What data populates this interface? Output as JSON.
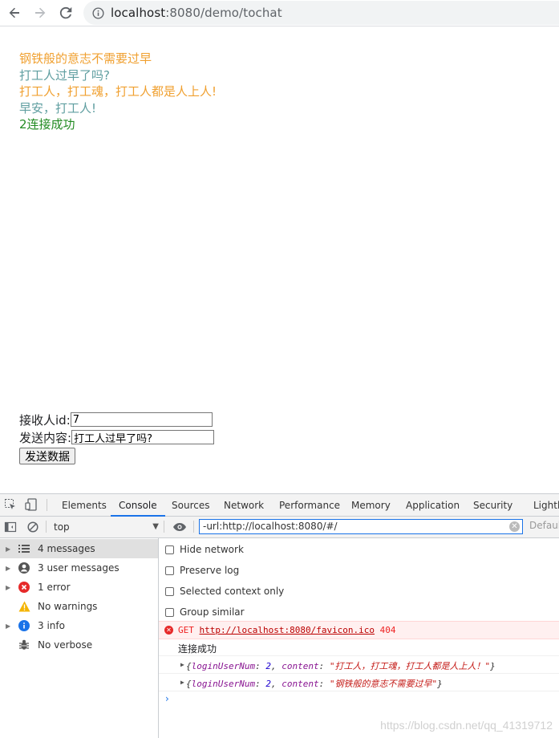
{
  "browser": {
    "url_host": "localhost",
    "url_rest": ":8080/demo/tochat"
  },
  "page": {
    "messages": [
      {
        "text": "钢铁般的意志不需要过早",
        "color": "#f0a030"
      },
      {
        "text": "打工人过早了吗?",
        "color": "#5f9ea0"
      },
      {
        "text": "打工人，打工魂，打工人都是人上人!",
        "color": "#f0a030"
      },
      {
        "text": "早安，打工人!",
        "color": "#5f9ea0"
      },
      {
        "text": "2连接成功",
        "color": "#228b22"
      }
    ],
    "form": {
      "receiver_label": "接收人id:",
      "receiver_value": "7",
      "content_label": "发送内容:",
      "content_value": "打工人过早了吗?",
      "send_label": "发送数据"
    }
  },
  "devtools": {
    "tabs": [
      "Elements",
      "Console",
      "Sources",
      "Network",
      "Performance",
      "Memory",
      "Application",
      "Security",
      "Lighth"
    ],
    "active_tab": "Console",
    "context": "top",
    "filter_value": "-url:http://localhost:8080/#/",
    "default_levels": "Default",
    "sidebar": [
      {
        "label": "4 messages",
        "icon": "list-icon",
        "selected": true
      },
      {
        "label": "3 user messages",
        "icon": "user-icon",
        "selected": false
      },
      {
        "label": "1 error",
        "icon": "error-icon",
        "selected": false
      },
      {
        "label": "No warnings",
        "icon": "warning-icon",
        "selected": false
      },
      {
        "label": "3 info",
        "icon": "info-icon",
        "selected": false
      },
      {
        "label": "No verbose",
        "icon": "bug-icon",
        "selected": false
      }
    ],
    "settings": [
      "Hide network",
      "Preserve log",
      "Selected context only",
      "Group similar"
    ],
    "console": {
      "error_method": "GET",
      "error_url": "http://localhost:8080/favicon.ico",
      "error_code": "404",
      "log_text": "连接成功",
      "objects": [
        {
          "k1": "loginUserNum",
          "v1": "2",
          "k2": "content",
          "v2": "\"打工人，打工魂，打工人都是人上人！\""
        },
        {
          "k1": "loginUserNum",
          "v1": "2",
          "k2": "content",
          "v2": "\"钢铁般的意志不需要过早\""
        }
      ],
      "prompt": "›"
    }
  },
  "watermark": "https://blog.csdn.net/qq_41319712"
}
